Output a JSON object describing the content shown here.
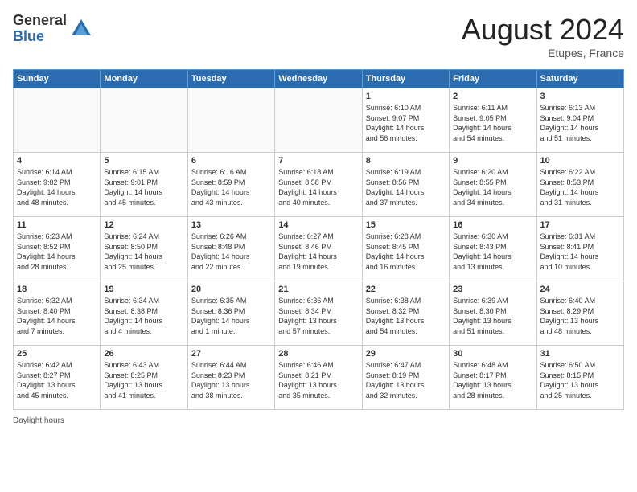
{
  "header": {
    "logo_general": "General",
    "logo_blue": "Blue",
    "month_year": "August 2024",
    "location": "Etupes, France"
  },
  "days_of_week": [
    "Sunday",
    "Monday",
    "Tuesday",
    "Wednesday",
    "Thursday",
    "Friday",
    "Saturday"
  ],
  "weeks": [
    [
      {
        "day": "",
        "info": ""
      },
      {
        "day": "",
        "info": ""
      },
      {
        "day": "",
        "info": ""
      },
      {
        "day": "",
        "info": ""
      },
      {
        "day": "1",
        "info": "Sunrise: 6:10 AM\nSunset: 9:07 PM\nDaylight: 14 hours\nand 56 minutes."
      },
      {
        "day": "2",
        "info": "Sunrise: 6:11 AM\nSunset: 9:05 PM\nDaylight: 14 hours\nand 54 minutes."
      },
      {
        "day": "3",
        "info": "Sunrise: 6:13 AM\nSunset: 9:04 PM\nDaylight: 14 hours\nand 51 minutes."
      }
    ],
    [
      {
        "day": "4",
        "info": "Sunrise: 6:14 AM\nSunset: 9:02 PM\nDaylight: 14 hours\nand 48 minutes."
      },
      {
        "day": "5",
        "info": "Sunrise: 6:15 AM\nSunset: 9:01 PM\nDaylight: 14 hours\nand 45 minutes."
      },
      {
        "day": "6",
        "info": "Sunrise: 6:16 AM\nSunset: 8:59 PM\nDaylight: 14 hours\nand 43 minutes."
      },
      {
        "day": "7",
        "info": "Sunrise: 6:18 AM\nSunset: 8:58 PM\nDaylight: 14 hours\nand 40 minutes."
      },
      {
        "day": "8",
        "info": "Sunrise: 6:19 AM\nSunset: 8:56 PM\nDaylight: 14 hours\nand 37 minutes."
      },
      {
        "day": "9",
        "info": "Sunrise: 6:20 AM\nSunset: 8:55 PM\nDaylight: 14 hours\nand 34 minutes."
      },
      {
        "day": "10",
        "info": "Sunrise: 6:22 AM\nSunset: 8:53 PM\nDaylight: 14 hours\nand 31 minutes."
      }
    ],
    [
      {
        "day": "11",
        "info": "Sunrise: 6:23 AM\nSunset: 8:52 PM\nDaylight: 14 hours\nand 28 minutes."
      },
      {
        "day": "12",
        "info": "Sunrise: 6:24 AM\nSunset: 8:50 PM\nDaylight: 14 hours\nand 25 minutes."
      },
      {
        "day": "13",
        "info": "Sunrise: 6:26 AM\nSunset: 8:48 PM\nDaylight: 14 hours\nand 22 minutes."
      },
      {
        "day": "14",
        "info": "Sunrise: 6:27 AM\nSunset: 8:46 PM\nDaylight: 14 hours\nand 19 minutes."
      },
      {
        "day": "15",
        "info": "Sunrise: 6:28 AM\nSunset: 8:45 PM\nDaylight: 14 hours\nand 16 minutes."
      },
      {
        "day": "16",
        "info": "Sunrise: 6:30 AM\nSunset: 8:43 PM\nDaylight: 14 hours\nand 13 minutes."
      },
      {
        "day": "17",
        "info": "Sunrise: 6:31 AM\nSunset: 8:41 PM\nDaylight: 14 hours\nand 10 minutes."
      }
    ],
    [
      {
        "day": "18",
        "info": "Sunrise: 6:32 AM\nSunset: 8:40 PM\nDaylight: 14 hours\nand 7 minutes."
      },
      {
        "day": "19",
        "info": "Sunrise: 6:34 AM\nSunset: 8:38 PM\nDaylight: 14 hours\nand 4 minutes."
      },
      {
        "day": "20",
        "info": "Sunrise: 6:35 AM\nSunset: 8:36 PM\nDaylight: 14 hours\nand 1 minute."
      },
      {
        "day": "21",
        "info": "Sunrise: 6:36 AM\nSunset: 8:34 PM\nDaylight: 13 hours\nand 57 minutes."
      },
      {
        "day": "22",
        "info": "Sunrise: 6:38 AM\nSunset: 8:32 PM\nDaylight: 13 hours\nand 54 minutes."
      },
      {
        "day": "23",
        "info": "Sunrise: 6:39 AM\nSunset: 8:30 PM\nDaylight: 13 hours\nand 51 minutes."
      },
      {
        "day": "24",
        "info": "Sunrise: 6:40 AM\nSunset: 8:29 PM\nDaylight: 13 hours\nand 48 minutes."
      }
    ],
    [
      {
        "day": "25",
        "info": "Sunrise: 6:42 AM\nSunset: 8:27 PM\nDaylight: 13 hours\nand 45 minutes."
      },
      {
        "day": "26",
        "info": "Sunrise: 6:43 AM\nSunset: 8:25 PM\nDaylight: 13 hours\nand 41 minutes."
      },
      {
        "day": "27",
        "info": "Sunrise: 6:44 AM\nSunset: 8:23 PM\nDaylight: 13 hours\nand 38 minutes."
      },
      {
        "day": "28",
        "info": "Sunrise: 6:46 AM\nSunset: 8:21 PM\nDaylight: 13 hours\nand 35 minutes."
      },
      {
        "day": "29",
        "info": "Sunrise: 6:47 AM\nSunset: 8:19 PM\nDaylight: 13 hours\nand 32 minutes."
      },
      {
        "day": "30",
        "info": "Sunrise: 6:48 AM\nSunset: 8:17 PM\nDaylight: 13 hours\nand 28 minutes."
      },
      {
        "day": "31",
        "info": "Sunrise: 6:50 AM\nSunset: 8:15 PM\nDaylight: 13 hours\nand 25 minutes."
      }
    ]
  ],
  "footer": {
    "daylight_hours_label": "Daylight hours"
  }
}
